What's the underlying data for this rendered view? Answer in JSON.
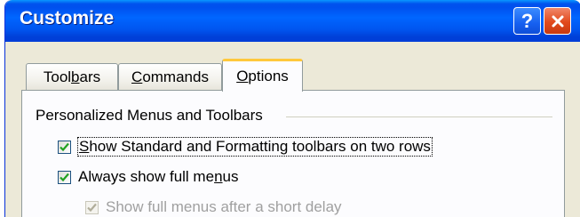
{
  "window": {
    "title": "Customize",
    "help_label": "?",
    "close_label": "close"
  },
  "tabs": [
    {
      "pre": "Tool",
      "key": "b",
      "post": "ars"
    },
    {
      "pre": "",
      "key": "C",
      "post": "ommands"
    },
    {
      "pre": "",
      "key": "O",
      "post": "ptions"
    }
  ],
  "group": {
    "label": "Personalized Menus and Toolbars"
  },
  "options": [
    {
      "pre": "",
      "key": "S",
      "post": "how Standard and Formatting toolbars on two rows",
      "checked": true,
      "enabled": true
    },
    {
      "pre": "Always show full me",
      "key": "n",
      "post": "us",
      "checked": true,
      "enabled": true
    },
    {
      "pre": "Show full menus after a short delay",
      "key": "",
      "post": "",
      "checked": true,
      "enabled": false
    }
  ],
  "colors": {
    "titlebar": "#0055f0",
    "dialog_bg": "#ece9d8",
    "tab_highlight": "#ffc83c",
    "close_button": "#e24a1d"
  }
}
